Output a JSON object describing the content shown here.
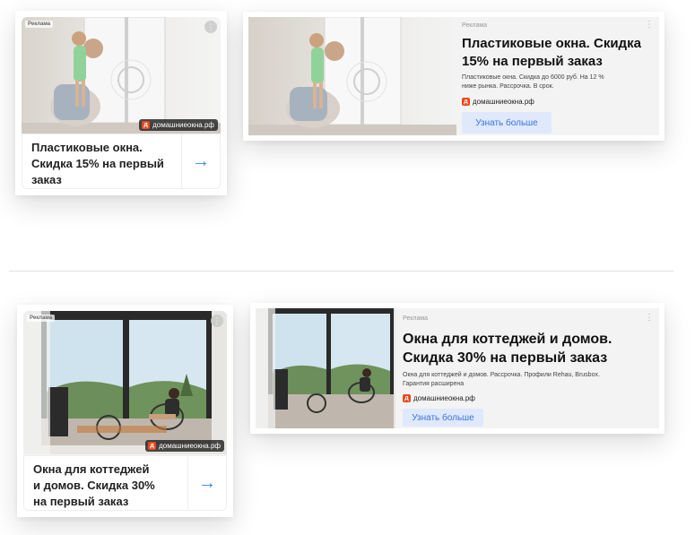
{
  "colors": {
    "accent": "#3b82f6",
    "button_bg": "#dfe9fb",
    "logo": "#e8491d"
  },
  "ad_label": "Реклама",
  "domain": "домашниеокна.рф",
  "cta": "Узнать больше",
  "arrow_icon": "→",
  "dots_icon": "⋮",
  "ad1": {
    "title_square_lines": [
      "Пластиковые окна.",
      "Скидка 15% на первый",
      "заказ"
    ],
    "title_wide_lines": [
      "Пластиковые окна. Скидка",
      "15% на первый заказ"
    ],
    "description_lines": [
      "Пластиковые окна. Скидка до 6000 руб. На 12 %",
      "ниже рынка. Рассрочка. В срок."
    ]
  },
  "ad2": {
    "title_square_lines": [
      "Окна для коттеджей",
      "и домов. Скидка 30%",
      "на первый заказ"
    ],
    "title_wide_lines": [
      "Окна для коттеджей и домов.",
      "Скидка 30% на первый заказ"
    ],
    "description_lines": [
      "Окна для коттеджей и домов. Рассрочка. Профили Rehau, Brusbox.",
      "Гарантия расширена"
    ]
  }
}
